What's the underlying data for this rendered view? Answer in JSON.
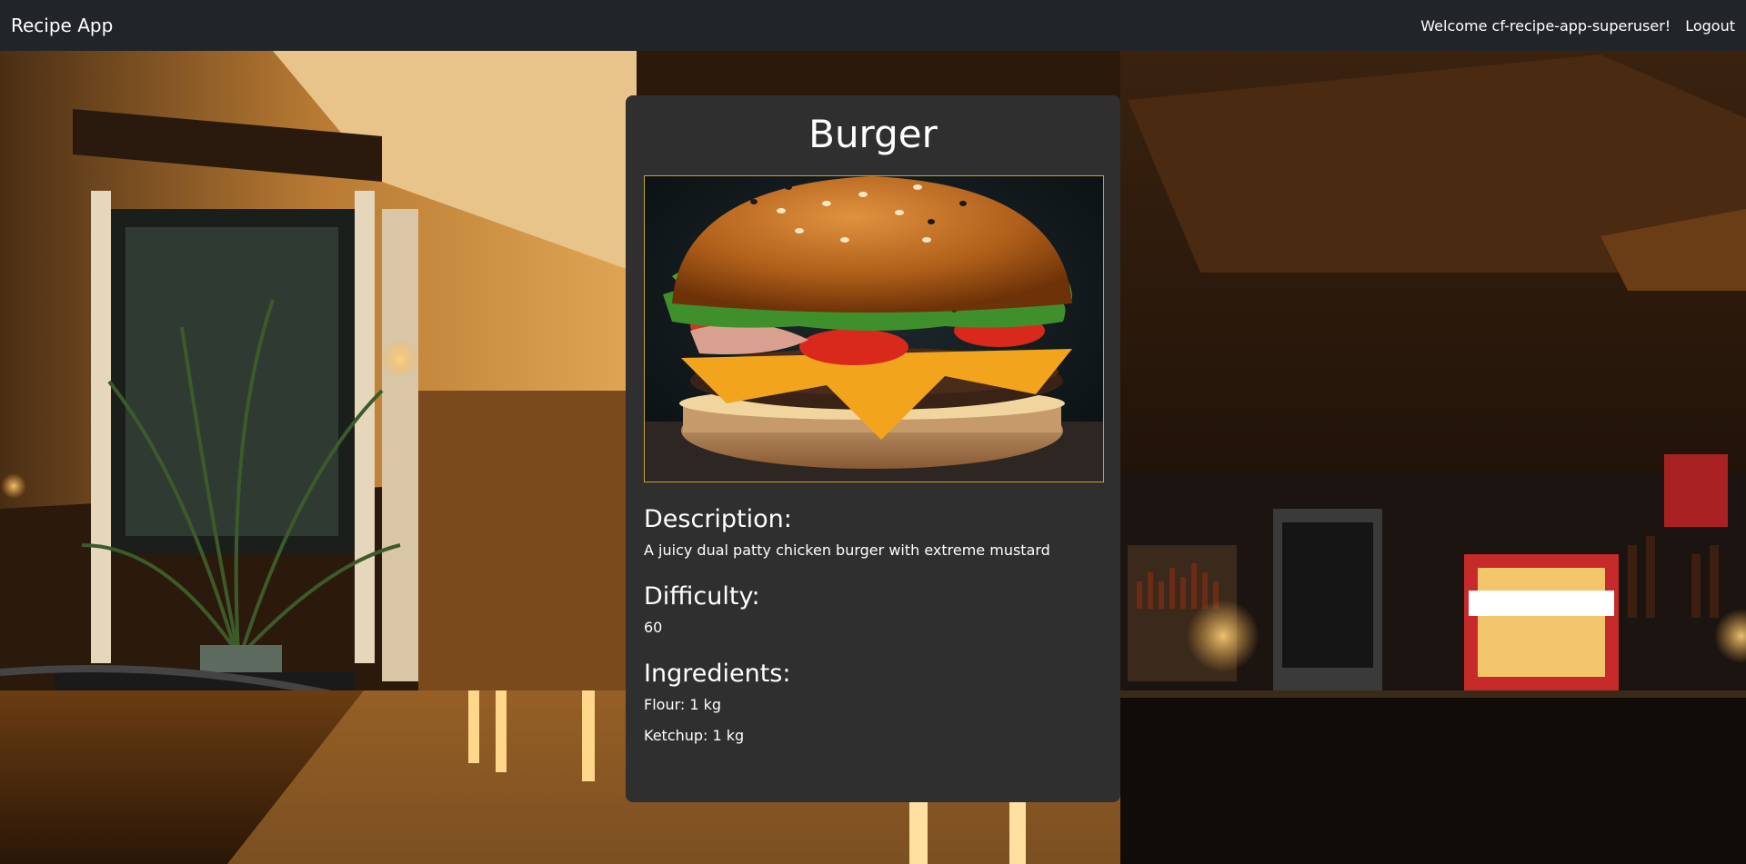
{
  "navbar": {
    "brand": "Recipe App",
    "welcome": "Welcome cf-recipe-app-superuser!",
    "logout": "Logout"
  },
  "recipe": {
    "title": "Burger",
    "image_icon": "burger-photo",
    "description_heading": "Description:",
    "description": "A juicy dual patty chicken burger with extreme mustard",
    "difficulty_heading": "Difficulty:",
    "difficulty": "60",
    "ingredients_heading": "Ingredients:",
    "ingredients": [
      "Flour: 1 kg",
      "Ketchup: 1 kg"
    ]
  },
  "colors": {
    "navbar_bg": "#212529",
    "card_bg": "#2f2f2f",
    "image_border": "#c9a227"
  }
}
